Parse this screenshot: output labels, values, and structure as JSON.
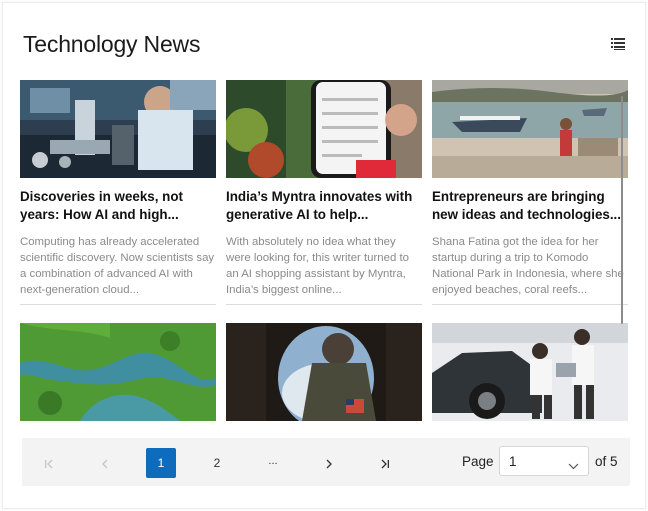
{
  "header": {
    "title": "Technology News",
    "view_icon": "list-view-icon"
  },
  "articles": [
    {
      "headline": "Discoveries in weeks, not years: How AI and high...",
      "summary": "Computing has already accelerated scientific discovery. Now scientists say a combination of advanced AI with next-generation cloud...",
      "image": "scientist-lab-photo"
    },
    {
      "headline": "India’s Myntra innovates with generative AI to help...",
      "summary": "With absolutely no idea what they were looking for, this writer turned to an AI shopping assistant by Myntra, India’s biggest online...",
      "image": "smartphone-in-hand-photo"
    },
    {
      "headline": "Entrepreneurs are bringing new ideas and technologies...",
      "summary": "Shana Fatina got the idea for her startup during a trip to Komodo National Park in Indonesia, where she enjoyed beaches, coral reefs...",
      "image": "boat-on-beach-photo"
    },
    {
      "image": "river-delta-aerial-photo"
    },
    {
      "image": "pilot-in-cockpit-photo"
    },
    {
      "image": "car-showroom-photo"
    }
  ],
  "pager": {
    "first_icon": "first-page-icon",
    "prev_icon": "previous-page-icon",
    "pages": [
      "1",
      "2",
      "..."
    ],
    "current_page": "1",
    "next_icon": "next-page-icon",
    "last_icon": "last-page-icon",
    "page_label": "Page",
    "page_select_value": "1",
    "of_label": "of 5"
  },
  "colors": {
    "accent": "#0f6cbd",
    "pager_background": "#f3f3f3",
    "summary_text": "#8a8a8a"
  }
}
